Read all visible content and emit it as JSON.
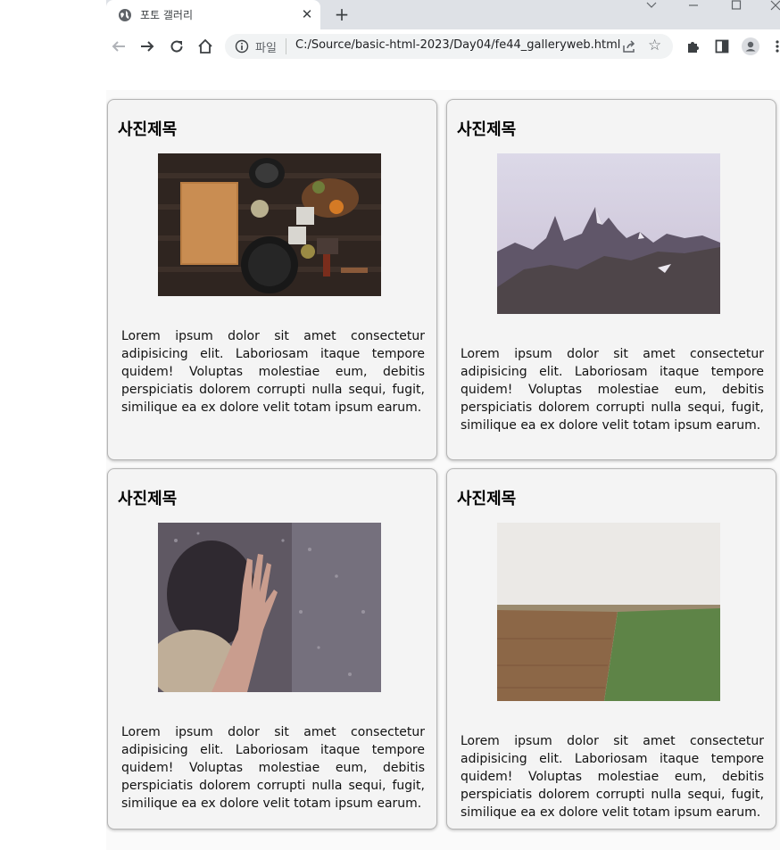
{
  "browser": {
    "tab_title": "포토 갤러리",
    "url_scheme_label": "파일",
    "url": "C:/Source/basic-html-2023/Day04/fe44_galleryweb.html"
  },
  "gallery": {
    "cards": [
      {
        "title": "사진제목",
        "photo": "kitchen-utensils-on-wooden-table-photo",
        "text": "Lorem ipsum dolor sit amet consectetur adipisicing elit. Laboriosam itaque tempore quidem! Voluptas molestiae eum, debitis perspiciatis dolorem corrupti nulla sequi, fugit, similique ea ex dolore velit totam ipsum earum."
      },
      {
        "title": "사진제목",
        "photo": "rocky-mountain-peaks-photo",
        "text": "Lorem ipsum dolor sit amet consectetur adipisicing elit. Laboriosam itaque tempore quidem! Voluptas molestiae eum, debitis perspiciatis dolorem corrupti nulla sequi, fugit, similique ea ex dolore velit totam ipsum earum."
      },
      {
        "title": "사진제목",
        "photo": "hand-on-rainy-window-photo",
        "text": "Lorem ipsum dolor sit amet consectetur adipisicing elit. Laboriosam itaque tempore quidem! Voluptas molestiae eum, debitis perspiciatis dolorem corrupti nulla sequi, fugit, similique ea ex dolore velit totam ipsum earum."
      },
      {
        "title": "사진제목",
        "photo": "plowed-and-green-field-photo",
        "text": "Lorem ipsum dolor sit amet consectetur adipisicing elit. Laboriosam itaque tempore quidem! Voluptas molestiae eum, debitis perspiciatis dolorem corrupti nulla sequi, fugit, similique ea ex dolore velit totam ipsum earum."
      }
    ]
  }
}
